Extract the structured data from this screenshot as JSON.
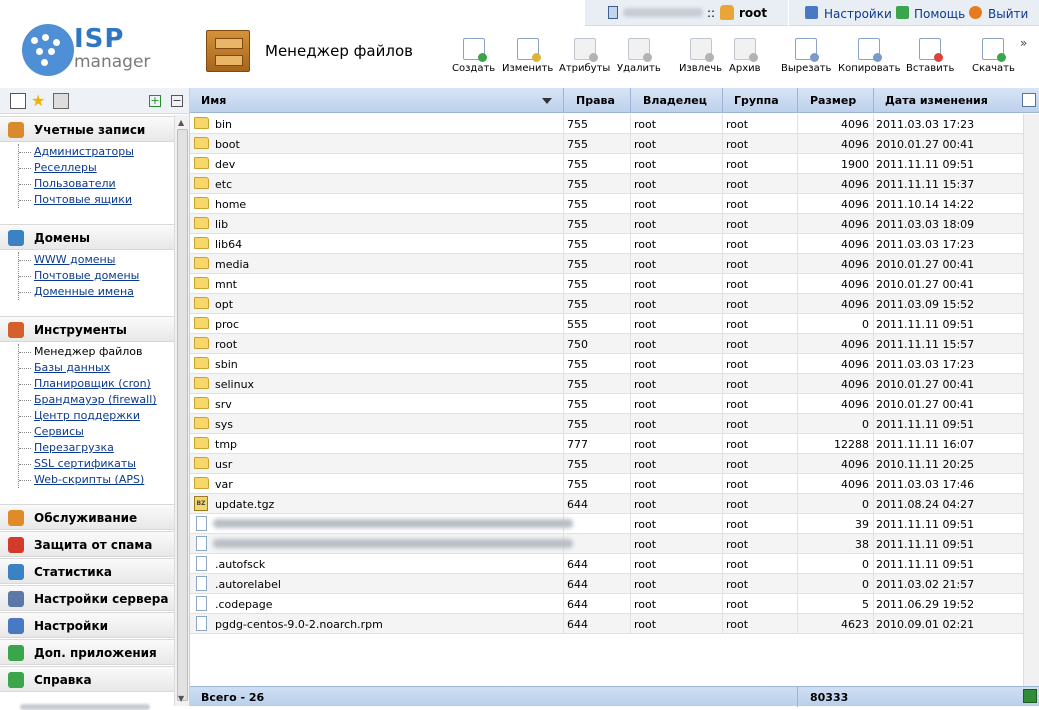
{
  "topbar": {
    "user": "root",
    "colon": "::",
    "links": [
      {
        "label": "Настройки",
        "icon": "settings-icon"
      },
      {
        "label": "Помощь",
        "icon": "help-icon"
      },
      {
        "label": "Выйти",
        "icon": "logout-icon"
      }
    ]
  },
  "logo": {
    "isp": "ISP",
    "manager": "manager"
  },
  "page_title": "Менеджер файлов",
  "toolbar": [
    {
      "label": "Создать",
      "icon": "create-icon",
      "color": "#3aa54a",
      "enabled": true
    },
    {
      "label": "Изменить",
      "icon": "edit-icon",
      "color": "#e2b238",
      "enabled": true
    },
    {
      "label": "Атрибуты",
      "icon": "attributes-icon",
      "color": "#b3b3b3",
      "enabled": false
    },
    {
      "label": "Удалить",
      "icon": "delete-icon",
      "color": "#b3b3b3",
      "enabled": false
    },
    {
      "label": "Извлечь",
      "icon": "extract-icon",
      "color": "#b3b3b3",
      "enabled": false
    },
    {
      "label": "Архив",
      "icon": "archive-icon",
      "color": "#b3b3b3",
      "enabled": false
    },
    {
      "label": "Вырезать",
      "icon": "cut-icon",
      "color": "#7a9ac8",
      "enabled": true
    },
    {
      "label": "Копировать",
      "icon": "copy-icon",
      "color": "#7a9ac8",
      "enabled": true
    },
    {
      "label": "Вставить",
      "icon": "paste-icon",
      "color": "#d9453c",
      "enabled": true
    },
    {
      "label": "Скачать",
      "icon": "download-icon",
      "color": "#3aa54a",
      "enabled": true
    }
  ],
  "toolbar_more": "»",
  "sidebar": {
    "sections": [
      {
        "title": "Учетные записи",
        "icon": "accounts-icon",
        "items": [
          "Администраторы",
          "Реселлеры",
          "Пользователи",
          "Почтовые ящики"
        ]
      },
      {
        "title": "Домены",
        "icon": "domains-icon",
        "items": [
          "WWW домены",
          "Почтовые домены",
          "Доменные имена"
        ]
      },
      {
        "title": "Инструменты",
        "icon": "tools-icon",
        "items": [
          "Менеджер файлов",
          "Базы данных",
          "Планировщик (cron)",
          "Брандмауэр (firewall)",
          "Центр поддержки",
          "Сервисы",
          "Перезагрузка",
          "SSL сертификаты",
          "Web-скрипты (APS)"
        ]
      },
      {
        "title": "Обслуживание",
        "icon": "maintenance-icon",
        "items": []
      },
      {
        "title": "Защита от спама",
        "icon": "spam-protection-icon",
        "items": []
      },
      {
        "title": "Статистика",
        "icon": "statistics-icon",
        "items": []
      },
      {
        "title": "Настройки сервера",
        "icon": "server-settings-icon",
        "items": []
      },
      {
        "title": "Настройки",
        "icon": "settings-icon",
        "items": []
      },
      {
        "title": "Доп. приложения",
        "icon": "addons-icon",
        "items": []
      },
      {
        "title": "Справка",
        "icon": "help-icon",
        "items": []
      }
    ],
    "active_item": "Менеджер файлов"
  },
  "grid": {
    "columns": [
      "Имя",
      "Права",
      "Владелец",
      "Группа",
      "Размер",
      "Дата изменения"
    ],
    "rows": [
      {
        "type": "folder",
        "name": "bin",
        "perm": "755",
        "owner": "root",
        "group": "root",
        "size": "4096",
        "date": "2011.03.03 17:23"
      },
      {
        "type": "folder",
        "name": "boot",
        "perm": "755",
        "owner": "root",
        "group": "root",
        "size": "4096",
        "date": "2010.01.27 00:41"
      },
      {
        "type": "folder",
        "name": "dev",
        "perm": "755",
        "owner": "root",
        "group": "root",
        "size": "1900",
        "date": "2011.11.11 09:51"
      },
      {
        "type": "folder",
        "name": "etc",
        "perm": "755",
        "owner": "root",
        "group": "root",
        "size": "4096",
        "date": "2011.11.11 15:37"
      },
      {
        "type": "folder",
        "name": "home",
        "perm": "755",
        "owner": "root",
        "group": "root",
        "size": "4096",
        "date": "2011.10.14 14:22"
      },
      {
        "type": "folder",
        "name": "lib",
        "perm": "755",
        "owner": "root",
        "group": "root",
        "size": "4096",
        "date": "2011.03.03 18:09"
      },
      {
        "type": "folder",
        "name": "lib64",
        "perm": "755",
        "owner": "root",
        "group": "root",
        "size": "4096",
        "date": "2011.03.03 17:23"
      },
      {
        "type": "folder",
        "name": "media",
        "perm": "755",
        "owner": "root",
        "group": "root",
        "size": "4096",
        "date": "2010.01.27 00:41"
      },
      {
        "type": "folder",
        "name": "mnt",
        "perm": "755",
        "owner": "root",
        "group": "root",
        "size": "4096",
        "date": "2010.01.27 00:41"
      },
      {
        "type": "folder",
        "name": "opt",
        "perm": "755",
        "owner": "root",
        "group": "root",
        "size": "4096",
        "date": "2011.03.09 15:52"
      },
      {
        "type": "folder",
        "name": "proc",
        "perm": "555",
        "owner": "root",
        "group": "root",
        "size": "0",
        "date": "2011.11.11 09:51"
      },
      {
        "type": "folder",
        "name": "root",
        "perm": "750",
        "owner": "root",
        "group": "root",
        "size": "4096",
        "date": "2011.11.11 15:57"
      },
      {
        "type": "folder",
        "name": "sbin",
        "perm": "755",
        "owner": "root",
        "group": "root",
        "size": "4096",
        "date": "2011.03.03 17:23"
      },
      {
        "type": "folder",
        "name": "selinux",
        "perm": "755",
        "owner": "root",
        "group": "root",
        "size": "4096",
        "date": "2010.01.27 00:41"
      },
      {
        "type": "folder",
        "name": "srv",
        "perm": "755",
        "owner": "root",
        "group": "root",
        "size": "4096",
        "date": "2010.01.27 00:41"
      },
      {
        "type": "folder",
        "name": "sys",
        "perm": "755",
        "owner": "root",
        "group": "root",
        "size": "0",
        "date": "2011.11.11 09:51"
      },
      {
        "type": "folder",
        "name": "tmp",
        "perm": "777",
        "owner": "root",
        "group": "root",
        "size": "12288",
        "date": "2011.11.11 16:07"
      },
      {
        "type": "folder",
        "name": "usr",
        "perm": "755",
        "owner": "root",
        "group": "root",
        "size": "4096",
        "date": "2010.11.11 20:25"
      },
      {
        "type": "folder",
        "name": "var",
        "perm": "755",
        "owner": "root",
        "group": "root",
        "size": "4096",
        "date": "2011.03.03 17:46"
      },
      {
        "type": "archive",
        "name": "update.tgz",
        "perm": "644",
        "owner": "root",
        "group": "root",
        "size": "0",
        "date": "2011.08.24 04:27"
      },
      {
        "type": "hidden",
        "name": "",
        "perm": "",
        "owner": "root",
        "group": "root",
        "size": "39",
        "date": "2011.11.11 09:51"
      },
      {
        "type": "hidden",
        "name": "",
        "perm": "",
        "owner": "root",
        "group": "root",
        "size": "38",
        "date": "2011.11.11 09:51"
      },
      {
        "type": "file",
        "name": ".autofsck",
        "perm": "644",
        "owner": "root",
        "group": "root",
        "size": "0",
        "date": "2011.11.11 09:51"
      },
      {
        "type": "file",
        "name": ".autorelabel",
        "perm": "644",
        "owner": "root",
        "group": "root",
        "size": "0",
        "date": "2011.03.02 21:57"
      },
      {
        "type": "file",
        "name": ".codepage",
        "perm": "644",
        "owner": "root",
        "group": "root",
        "size": "5",
        "date": "2011.06.29 19:52"
      },
      {
        "type": "file",
        "name": "pgdg-centos-9.0-2.noarch.rpm",
        "perm": "644",
        "owner": "root",
        "group": "root",
        "size": "4623",
        "date": "2010.09.01 02:21"
      }
    ],
    "footer": {
      "total_label": "Всего - 26",
      "total_size": "80333"
    }
  }
}
